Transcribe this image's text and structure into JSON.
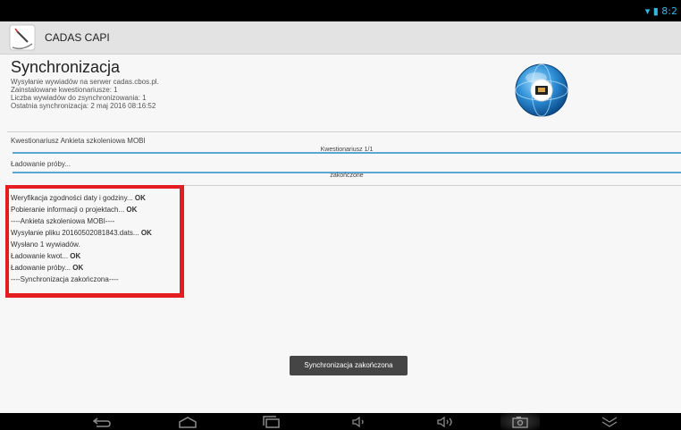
{
  "status_bar": {
    "time": "8:2"
  },
  "app": {
    "title": "CADAS CAPI"
  },
  "sync": {
    "title": "Synchronizacja",
    "lines": [
      "Wysyłanie wywiadów na serwer cadas.cbos.pl.",
      "Zainstalowane kwestionariusze: 1",
      "Liczba wywiadów do zsynchronizowania: 1",
      "Ostatnia synchronizacja: 2 maj 2016 08:16:52"
    ]
  },
  "progress": {
    "questionnaire_label": "Kwestionariusz Ankieta szkoleniowa MOBI",
    "questionnaire_bar_text": "Kwestionariusz 1/1",
    "questionnaire_progress": 1.0,
    "sample_label": "Ładowanie próby...",
    "sample_bar_text": "zakończone",
    "sample_progress": 1.0
  },
  "log": [
    {
      "text": "Weryfikacja zgodności daty i godziny...",
      "status": "OK"
    },
    {
      "text": "Pobieranie informacji o projektach...",
      "status": "OK"
    },
    {
      "text": "----Ankieta szkoleniowa MOBI----",
      "status": ""
    },
    {
      "text": "Wysyłanie pliku 20160502081843.dats...",
      "status": "OK"
    },
    {
      "text": "Wysłano 1 wywiadów.",
      "status": ""
    },
    {
      "text": "Ładowanie kwot...",
      "status": "OK"
    },
    {
      "text": "Ładowanie próby...",
      "status": "OK"
    },
    {
      "text": "----Synchronizacja zakończona----",
      "status": ""
    }
  ],
  "toast": {
    "text": "Synchronizacja zakończona"
  },
  "colors": {
    "progress": "#5aa7d6",
    "highlight": "#e41e20",
    "status_icon": "#33b5e5"
  },
  "nav": {
    "icons": [
      "back-icon",
      "home-icon",
      "recents-icon",
      "volume-down-icon",
      "volume-up-icon",
      "screenshot-icon",
      "collapse-icon"
    ]
  }
}
